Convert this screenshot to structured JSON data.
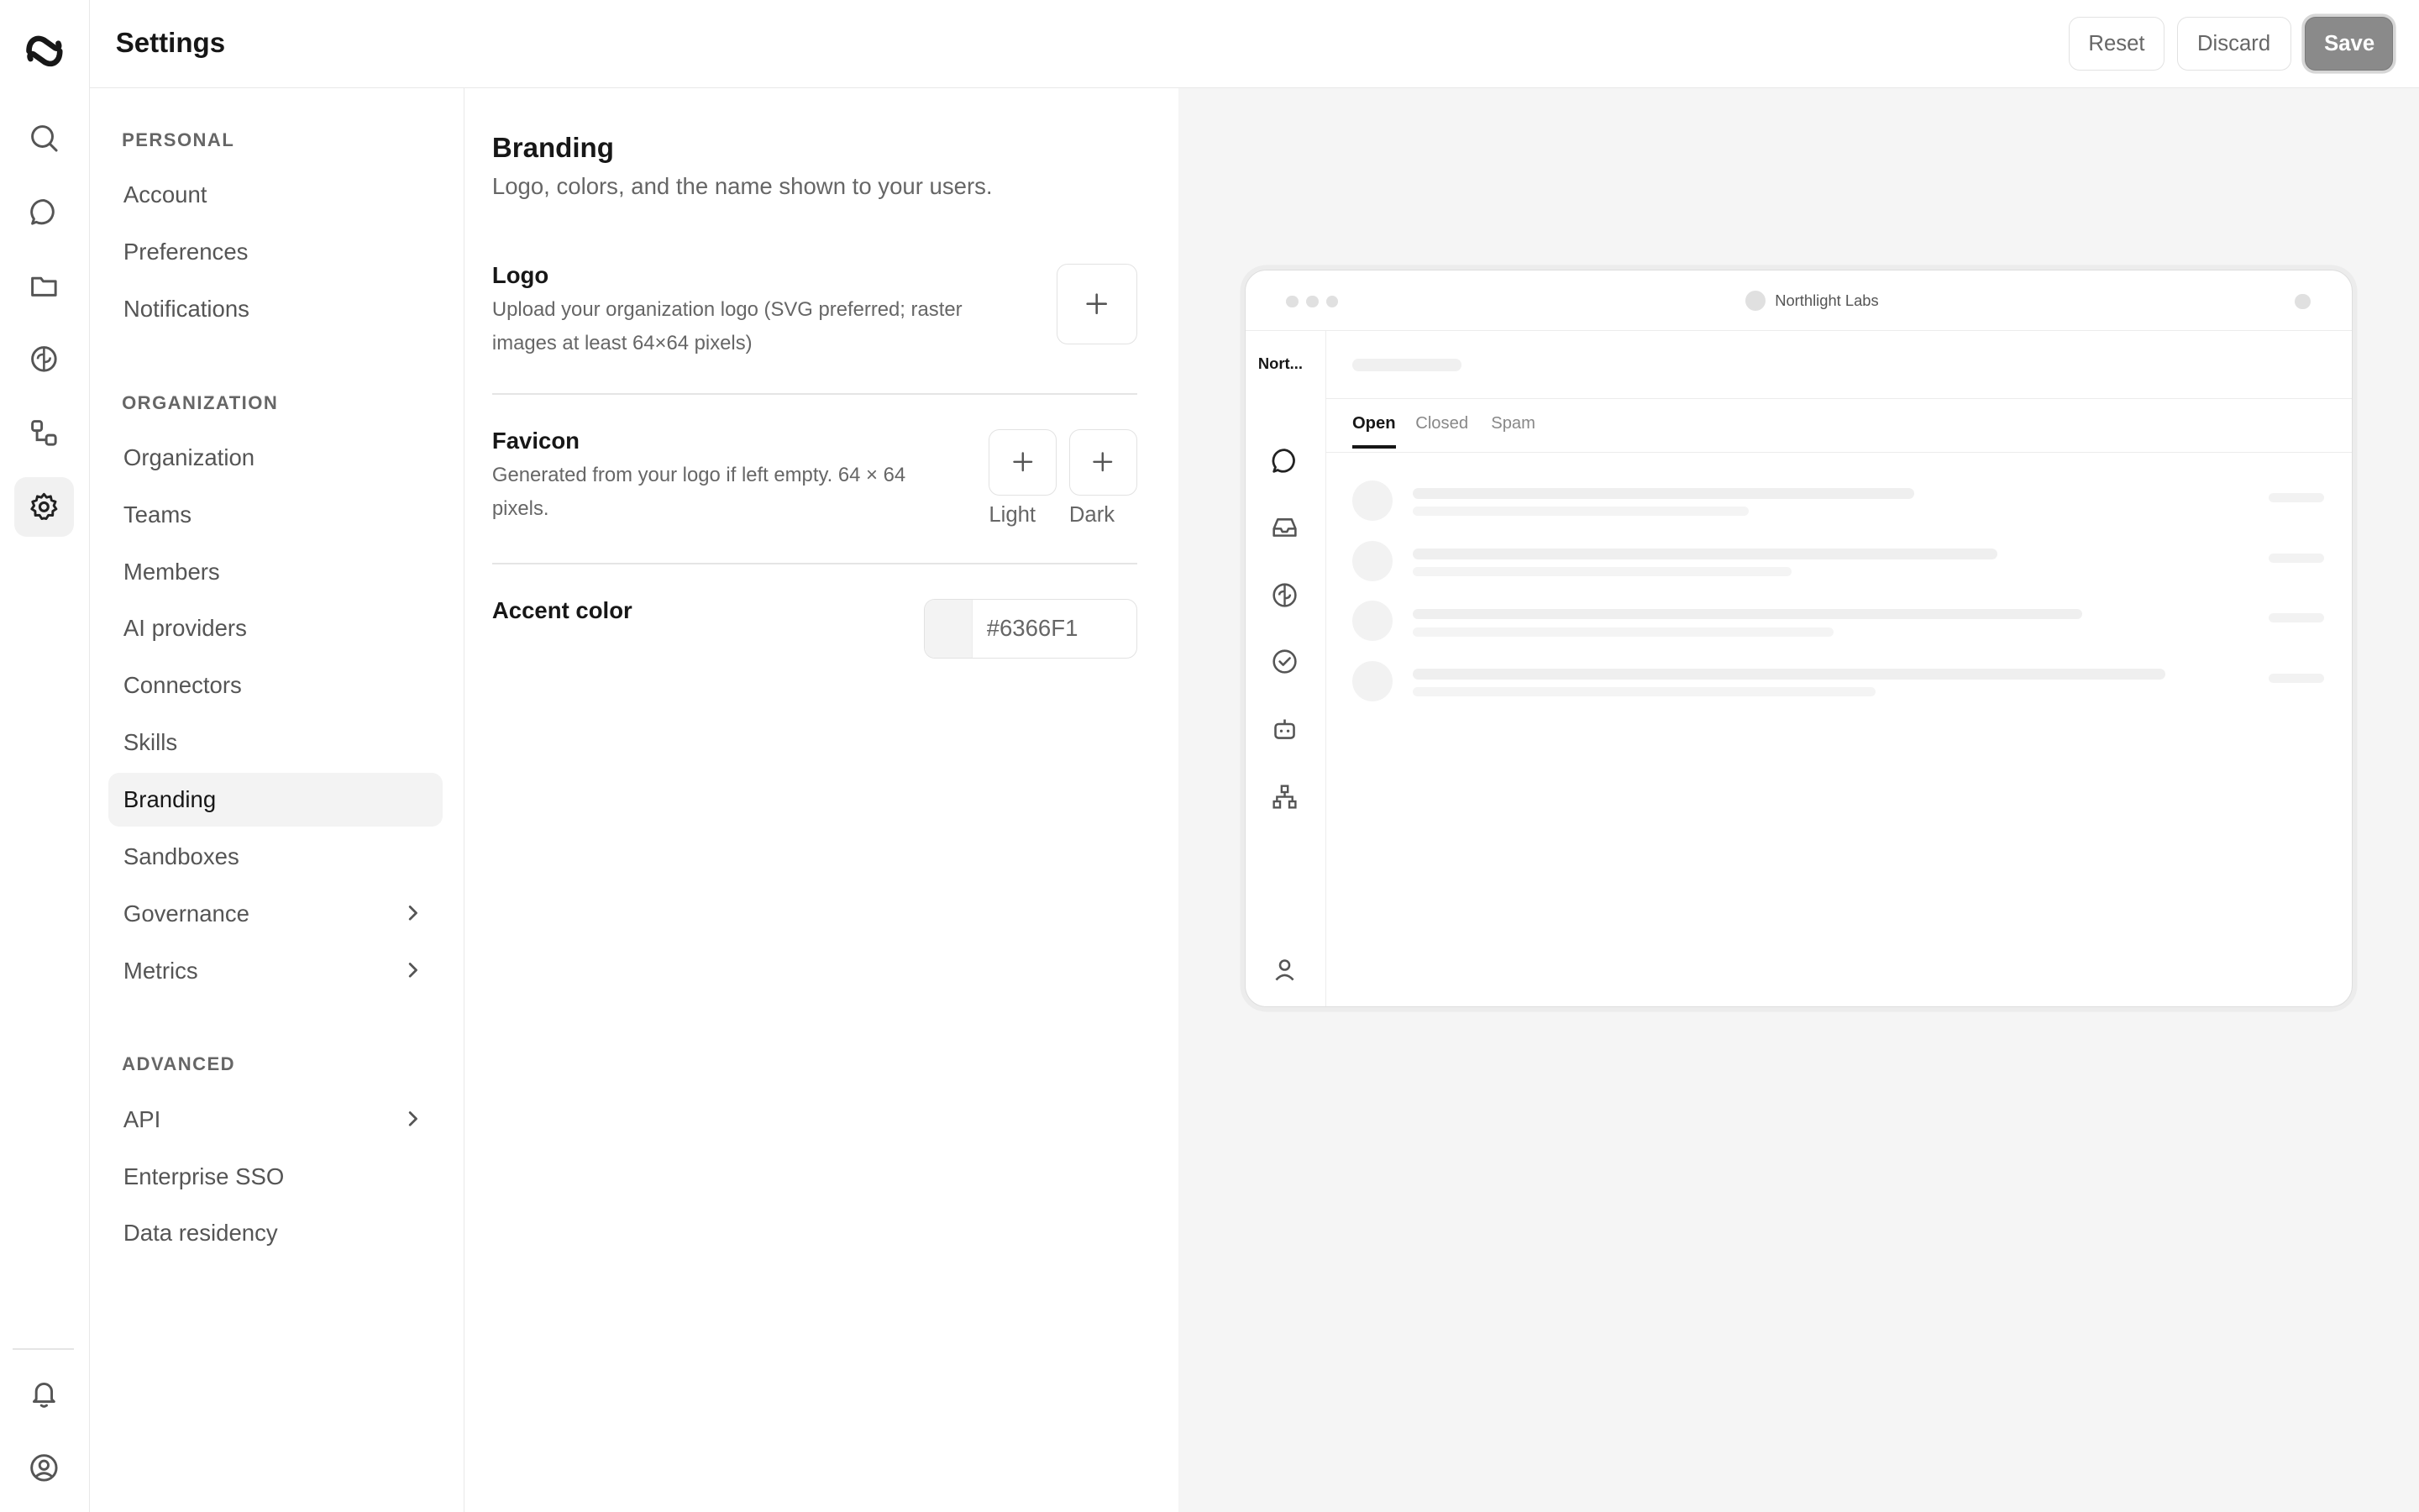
{
  "header": {
    "title": "Settings",
    "reset_label": "Reset",
    "discard_label": "Discard",
    "save_label": "Save"
  },
  "rail": {
    "icons": [
      "logo-icon",
      "search-icon",
      "chat-icon",
      "folder-icon",
      "brain-icon",
      "workflow-icon",
      "gear-icon",
      "bell-icon",
      "user-circle-icon"
    ],
    "active": "gear-icon"
  },
  "nav": {
    "sections": [
      {
        "title": "PERSONAL",
        "items": [
          "Account",
          "Preferences",
          "Notifications"
        ]
      },
      {
        "title": "ORGANIZATION",
        "items": [
          "Organization",
          "Teams",
          "Members",
          "AI providers",
          "Connectors",
          "Skills",
          "Branding",
          "Sandboxes",
          "Governance",
          "Metrics"
        ]
      },
      {
        "title": "ADVANCED",
        "items": [
          "API",
          "Enterprise SSO",
          "Data residency"
        ]
      }
    ],
    "active_item": "Branding",
    "expandable": [
      "Governance",
      "Metrics",
      "API"
    ]
  },
  "content": {
    "title": "Branding",
    "subtitle": "Logo, colors, and the name shown to your users.",
    "logo": {
      "label": "Logo",
      "desc_line1": "Upload your organization logo (SVG preferred; raster",
      "desc_line2": "images at least 64×64 pixels)"
    },
    "favicon": {
      "label": "Favicon",
      "desc_line1": "Generated from your logo if left empty. 64 × 64",
      "desc_line2": "pixels.",
      "light_label": "Light",
      "dark_label": "Dark"
    },
    "accent": {
      "label": "Accent color",
      "value": "#6366F1"
    }
  },
  "preview": {
    "window_title": "Northlight Labs",
    "org_short": "Nort...",
    "tabs": [
      "Open",
      "Closed",
      "Spam"
    ],
    "active_tab": "Open"
  },
  "colors": {
    "save_bg": "#8a8a8a",
    "preview_bg": "#f5f5f5",
    "active_nav_bg": "#f3f3f3"
  }
}
